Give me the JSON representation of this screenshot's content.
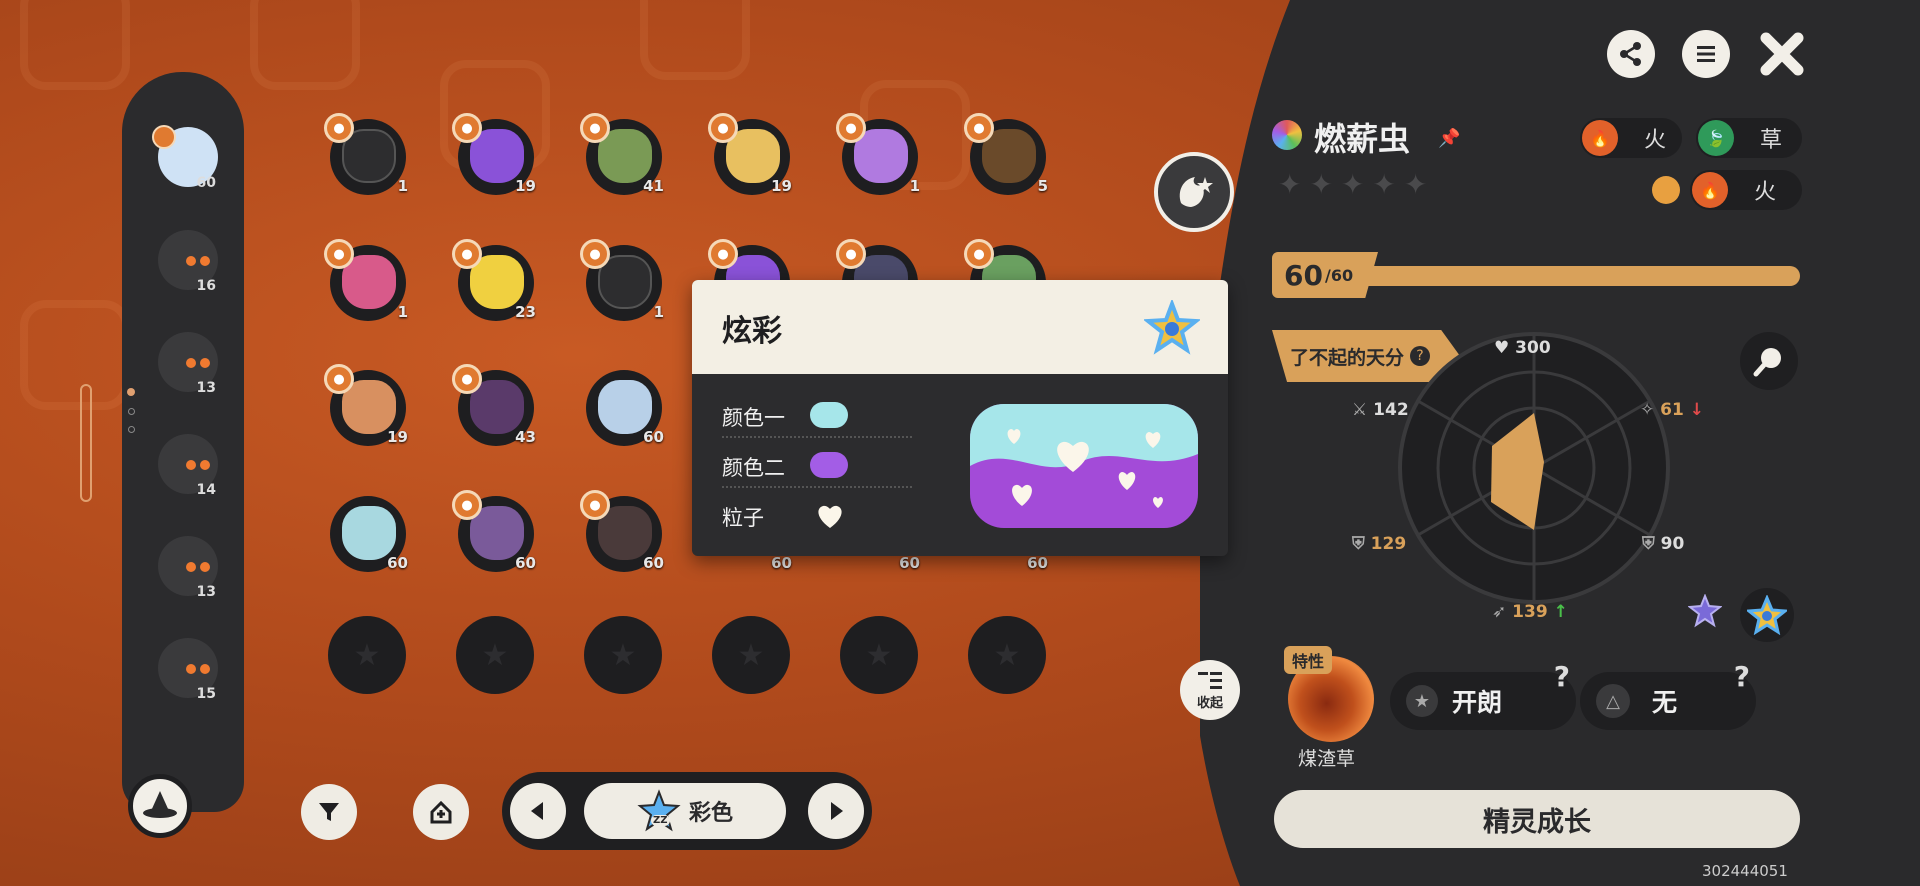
{
  "sidebar": {
    "pets": [
      {
        "level": "60"
      },
      {
        "level": "16"
      },
      {
        "level": "13"
      },
      {
        "level": "14"
      },
      {
        "level": "13"
      },
      {
        "level": "15"
      }
    ]
  },
  "grid": {
    "rows": [
      [
        {
          "level": "1",
          "color": "#2d2d2f"
        },
        {
          "level": "19",
          "color": "#8a52d8"
        },
        {
          "level": "41",
          "color": "#7a9a55"
        },
        {
          "level": "19",
          "color": "#e8c060"
        },
        {
          "level": "1",
          "color": "#b07ae0"
        },
        {
          "level": "5",
          "color": "#6a4a2a"
        }
      ],
      [
        {
          "level": "1",
          "color": "#d85a8a"
        },
        {
          "level": "23",
          "color": "#f0d040"
        },
        {
          "level": "1",
          "color": "#2d2d2f"
        },
        {
          "level": "",
          "color": "#8a52d8"
        },
        {
          "level": "",
          "color": "#4a4a6a"
        },
        {
          "level": "",
          "color": "#6aa060"
        }
      ],
      [
        {
          "level": "19",
          "color": "#d89060"
        },
        {
          "level": "43",
          "color": "#5a3a6a"
        },
        {
          "level": "60",
          "color": "#b8d0e8"
        }
      ],
      [
        {
          "level": "60",
          "color": "#a8d8e0"
        },
        {
          "level": "60",
          "color": "#7a5a9a"
        },
        {
          "level": "60",
          "color": "#4a3a3a"
        },
        {
          "level": "60",
          "color": ""
        },
        {
          "level": "60",
          "color": ""
        },
        {
          "level": "60",
          "color": ""
        }
      ]
    ]
  },
  "bottom": {
    "filter_icon": "funnel-icon",
    "sort_icon": "sort-icon",
    "variant_label": "彩色",
    "variant_badge": "ZZ"
  },
  "popup": {
    "title": "炫彩",
    "rows": [
      {
        "label": "颜色一",
        "color": "#a6e6ea"
      },
      {
        "label": "颜色二",
        "color": "#a35de6"
      },
      {
        "label": "粒子",
        "icon": "heart-icon"
      }
    ]
  },
  "pet": {
    "name": "燃薪虫",
    "stars": 5,
    "elements": [
      {
        "label": "火",
        "color": "#e2612a"
      },
      {
        "label": "草",
        "color": "#2f9a5a"
      }
    ],
    "fruit_element": {
      "label": "火",
      "color": "#e2612a"
    },
    "level": "60",
    "level_max": "60",
    "talent_label": "了不起的天分",
    "stats": {
      "hp": "300",
      "atk": "142",
      "matk": "61",
      "def": "129",
      "mdef": "90",
      "speed": "139"
    },
    "trait_badge": "特性",
    "trait_name": "煤渣草",
    "trait_btn1": "开朗",
    "trait_btn2": "无",
    "collapse_label": "收起",
    "grow_button": "精灵成长"
  },
  "footer": {
    "id_text": "302444051"
  },
  "colors": {
    "accent": "#d9a15a",
    "panel": "#2a2a2c",
    "bg": "#b04a1c"
  }
}
